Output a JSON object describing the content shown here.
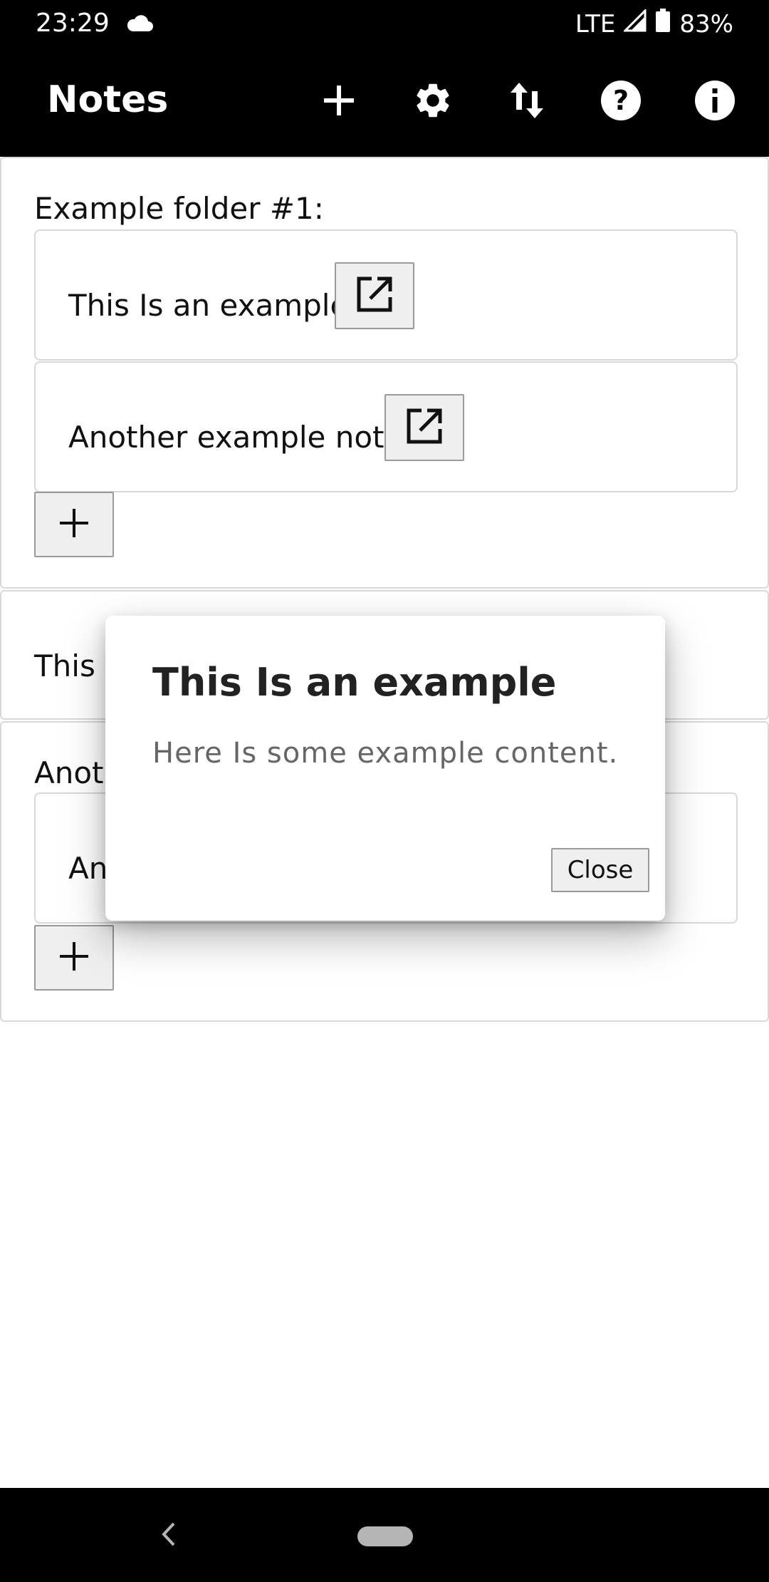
{
  "status_bar": {
    "time": "23:29",
    "network": "LTE",
    "battery": "83%",
    "icons": [
      "cloud-icon",
      "signal-icon",
      "battery-icon"
    ]
  },
  "app_bar": {
    "title": "Notes",
    "actions": [
      "add-icon",
      "settings-icon",
      "swap-vert-icon",
      "help-icon",
      "info-icon"
    ]
  },
  "folders": [
    {
      "title": "Example folder #1:",
      "notes": [
        {
          "label": "This Is an example"
        },
        {
          "label": "Another example note"
        }
      ]
    },
    {
      "title": "This n"
    },
    {
      "title": "Anoth",
      "notes": [
        {
          "label": "An"
        }
      ]
    }
  ],
  "dialog": {
    "title": "This Is an example",
    "body": "Here Is some example content.",
    "close_label": "Close"
  },
  "nav_bar": {
    "icons": [
      "back-icon",
      "home-pill-icon"
    ]
  },
  "colors": {
    "bars": "#000000",
    "card_border": "#d8d8d8",
    "button_bg": "#efefef",
    "button_border": "#9a9a9a",
    "dialog_body_text": "#666666"
  }
}
